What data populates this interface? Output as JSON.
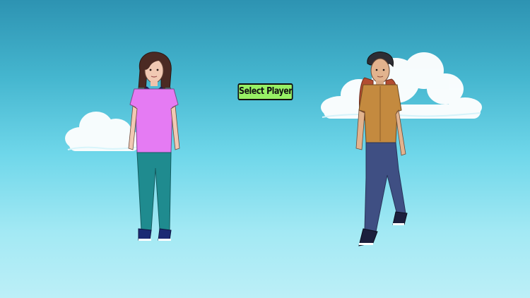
{
  "screen": {
    "name": "player-select",
    "select_button_label": "Select Player"
  },
  "players": [
    {
      "id": "girl",
      "shirt_color": "#e57bf3",
      "pants_color": "#1f8b8f",
      "hair_color": "#4b2a23"
    },
    {
      "id": "boy",
      "shirt_color": "#c48a3f",
      "pants_color": "#3f4f83",
      "backpack_color": "#b24d31"
    }
  ],
  "theme": {
    "sky_top": "#2d93b2",
    "sky_bottom": "#bceff7",
    "cloud": "#ffffff",
    "button_bg": "#97f065"
  }
}
